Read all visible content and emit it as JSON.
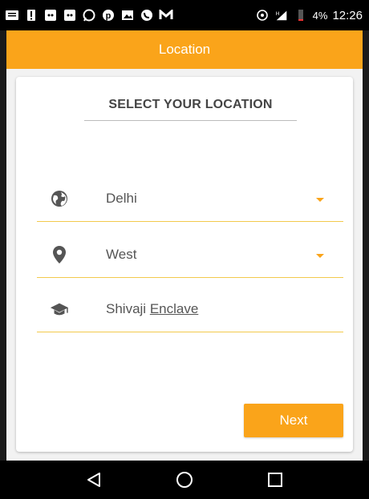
{
  "status_bar": {
    "battery_percent": "4%",
    "time": "12:26",
    "notification_icons": [
      "message-icon",
      "alert-icon",
      "cat-app-icon",
      "cat-app-icon-2",
      "whatsapp-icon",
      "pinterest-icon",
      "gallery-icon",
      "phone-icon",
      "gmail-icon"
    ],
    "signal_label": "H"
  },
  "app_bar": {
    "title": "Location"
  },
  "card": {
    "title": "SELECT YOUR LOCATION",
    "fields": [
      {
        "icon": "globe-icon",
        "value": "Delhi",
        "has_dropdown": true
      },
      {
        "icon": "location-pin-icon",
        "value": "West",
        "has_dropdown": true
      },
      {
        "icon": "graduation-cap-icon",
        "value_part1": "Shivaji ",
        "value_part2": "Enclave",
        "has_dropdown": false
      }
    ]
  },
  "next_button": {
    "label": "Next"
  },
  "colors": {
    "accent": "#FAA41A",
    "underline": "#F2C94C"
  }
}
